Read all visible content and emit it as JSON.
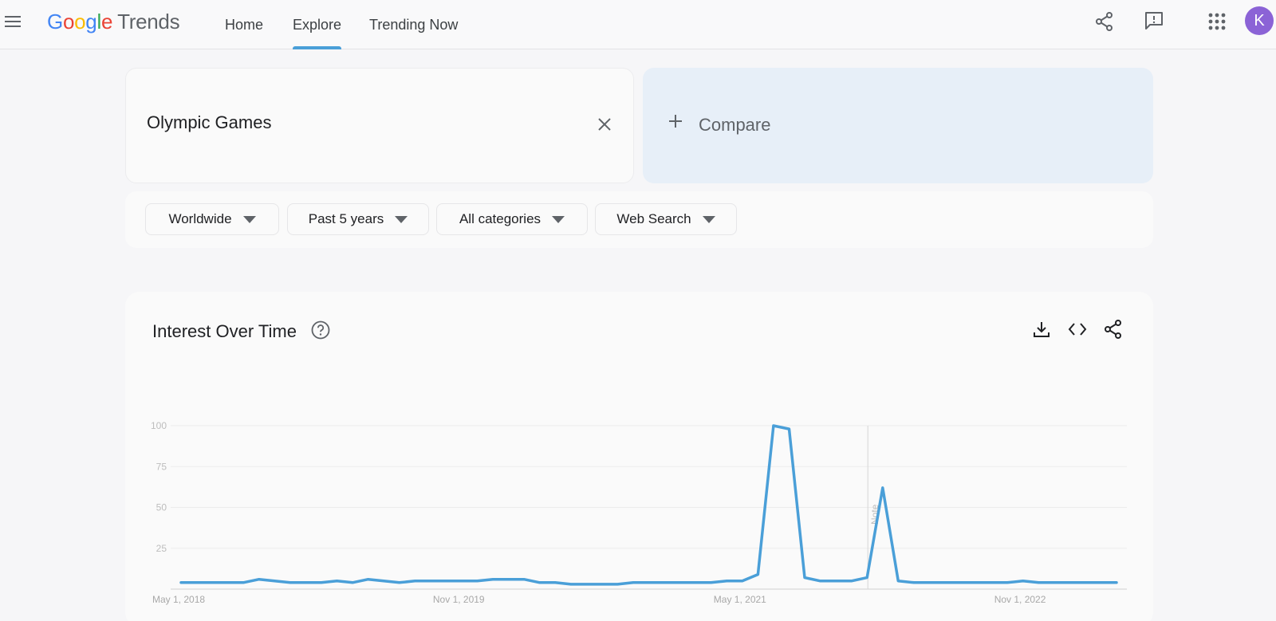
{
  "header": {
    "logo_google": "Google",
    "logo_trends": "Trends",
    "nav": [
      "Home",
      "Explore",
      "Trending Now"
    ],
    "active_nav": "Explore",
    "avatar_initial": "K"
  },
  "search": {
    "term": "Olympic Games",
    "compare_label": "Compare"
  },
  "filters": {
    "region": "Worldwide",
    "time": "Past 5 years",
    "category": "All categories",
    "property": "Web Search"
  },
  "chart_card": {
    "title": "Interest Over Time"
  },
  "chart_data": {
    "type": "line",
    "title": "",
    "xlabel": "",
    "ylabel": "",
    "ylim": [
      0,
      100
    ],
    "yticks": [
      25,
      50,
      75,
      100
    ],
    "xtick_labels": [
      "May 1, 2018",
      "Nov 1, 2019",
      "May 1, 2021",
      "Nov 1, 2022"
    ],
    "annotation": "Note",
    "color": "#4a9fd8",
    "series": [
      {
        "values": [
          4,
          4,
          4,
          4,
          4,
          6,
          5,
          4,
          4,
          4,
          5,
          4,
          6,
          5,
          4,
          5,
          5,
          5,
          5,
          5,
          6,
          6,
          6,
          4,
          4,
          3,
          3,
          3,
          3,
          4,
          4,
          4,
          4,
          4,
          4,
          5,
          5,
          9,
          100,
          98,
          7,
          5,
          5,
          5,
          7,
          62,
          5,
          4,
          4,
          4,
          4,
          4,
          4,
          4,
          5,
          4,
          4,
          4,
          4,
          4,
          4
        ]
      }
    ]
  }
}
